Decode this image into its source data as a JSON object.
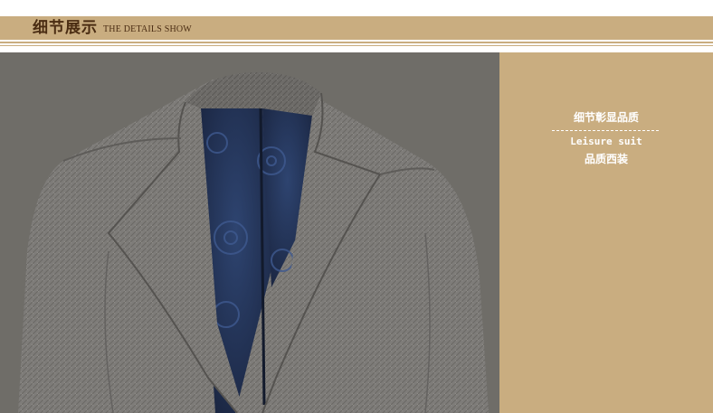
{
  "header": {
    "title": "细节展示",
    "subtitle": "THE DETAILS SHOW"
  },
  "side_panel": {
    "title": "细节彰显品质",
    "english": "Leisure suit",
    "chinese": "品质西装"
  },
  "colors": {
    "banner": "#c9ad80",
    "banner_text": "#4a2c12",
    "photo_background": "#6f6d68",
    "fabric": "#7d7b78",
    "lining": "#243352"
  },
  "image": {
    "subject": "grey tweed suit jacket with blue gear-print lining"
  }
}
